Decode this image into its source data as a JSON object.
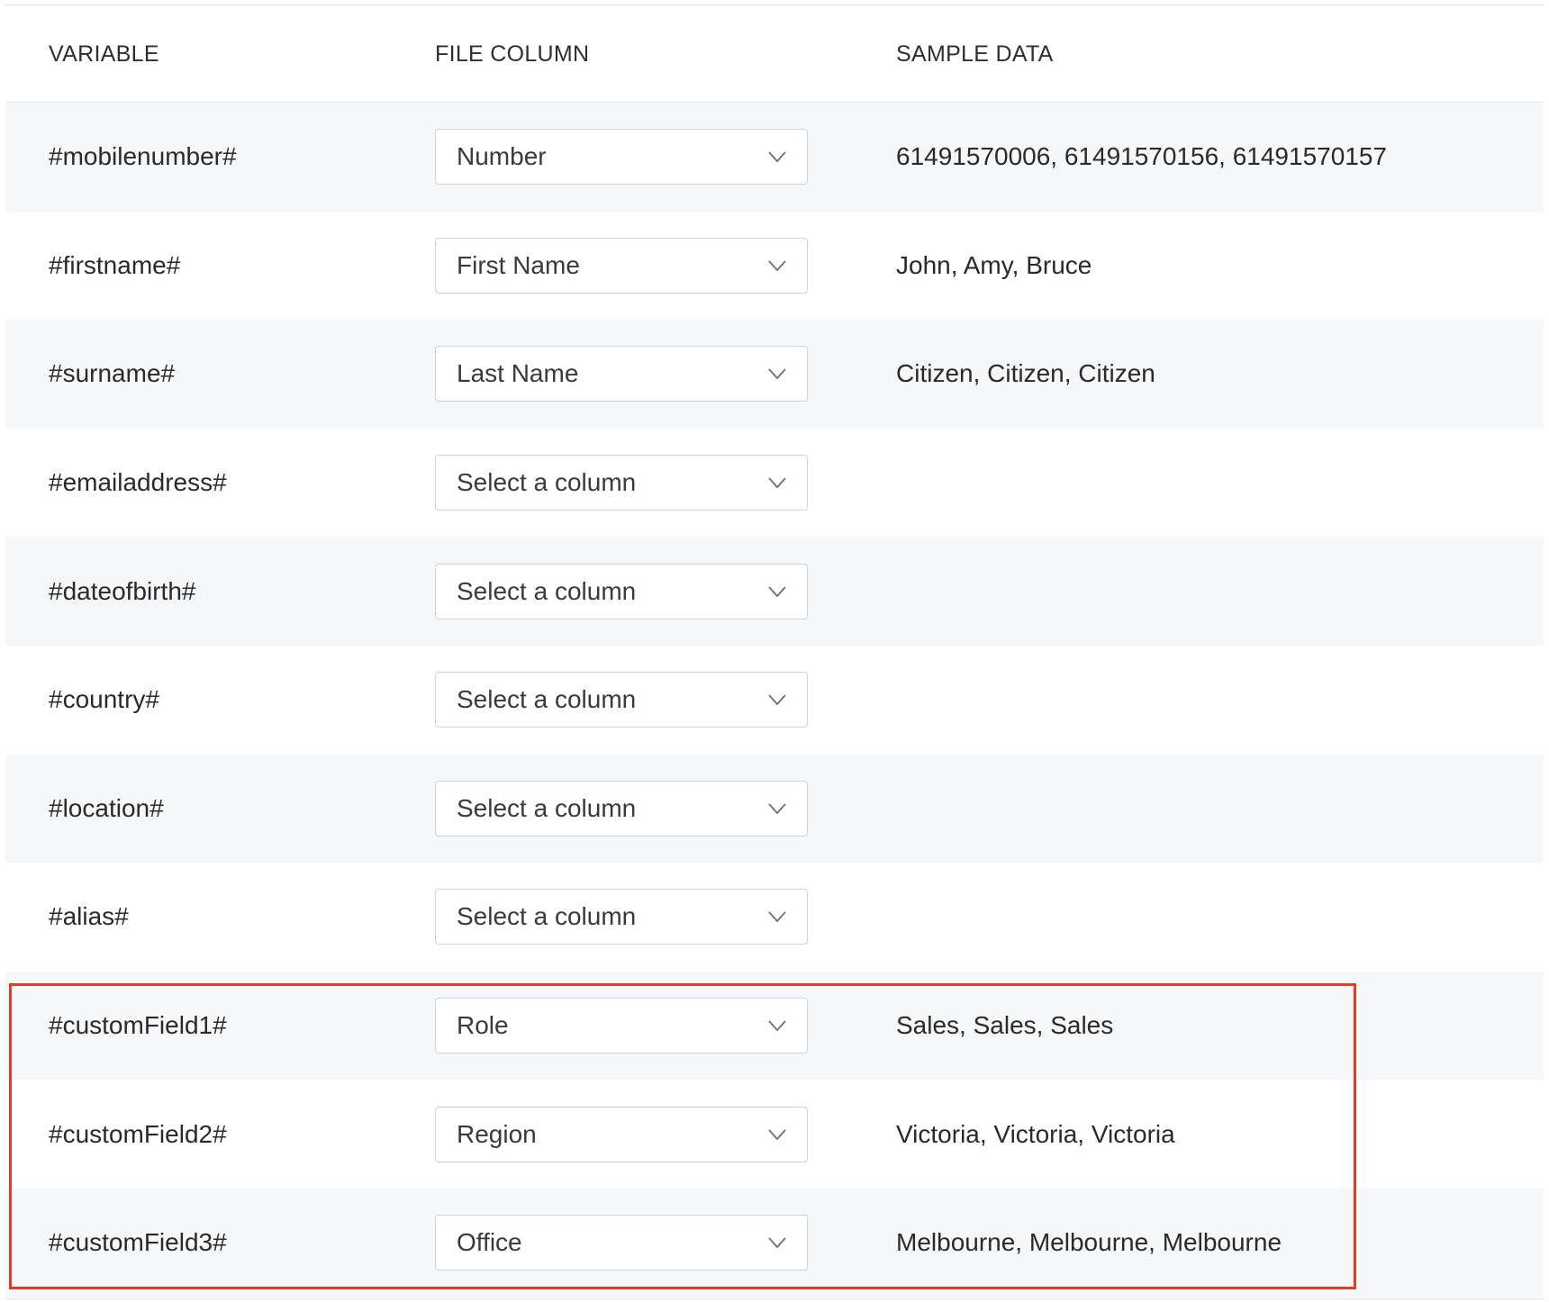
{
  "header": {
    "variable": "VARIABLE",
    "file_column": "FILE COLUMN",
    "sample_data": "SAMPLE DATA"
  },
  "rows": [
    {
      "variable": "#mobilenumber#",
      "column": "Number",
      "sample": "61491570006, 61491570156, 61491570157"
    },
    {
      "variable": "#firstname#",
      "column": "First Name",
      "sample": "John, Amy, Bruce"
    },
    {
      "variable": "#surname#",
      "column": "Last Name",
      "sample": "Citizen, Citizen, Citizen"
    },
    {
      "variable": "#emailaddress#",
      "column": "Select a column",
      "sample": ""
    },
    {
      "variable": "#dateofbirth#",
      "column": "Select a column",
      "sample": ""
    },
    {
      "variable": "#country#",
      "column": "Select a column",
      "sample": ""
    },
    {
      "variable": "#location#",
      "column": "Select a column",
      "sample": ""
    },
    {
      "variable": "#alias#",
      "column": "Select a column",
      "sample": ""
    },
    {
      "variable": "#customField1#",
      "column": "Role",
      "sample": "Sales, Sales, Sales"
    },
    {
      "variable": "#customField2#",
      "column": "Region",
      "sample": "Victoria, Victoria, Victoria"
    },
    {
      "variable": "#customField3#",
      "column": "Office",
      "sample": "Melbourne, Melbourne, Melbourne"
    }
  ],
  "colors": {
    "row_shade": "#f6f7f8",
    "highlight": "#e13b2b",
    "border": "#cfd3d8"
  },
  "icons": {
    "select_arrow": "chevron-down-icon"
  }
}
